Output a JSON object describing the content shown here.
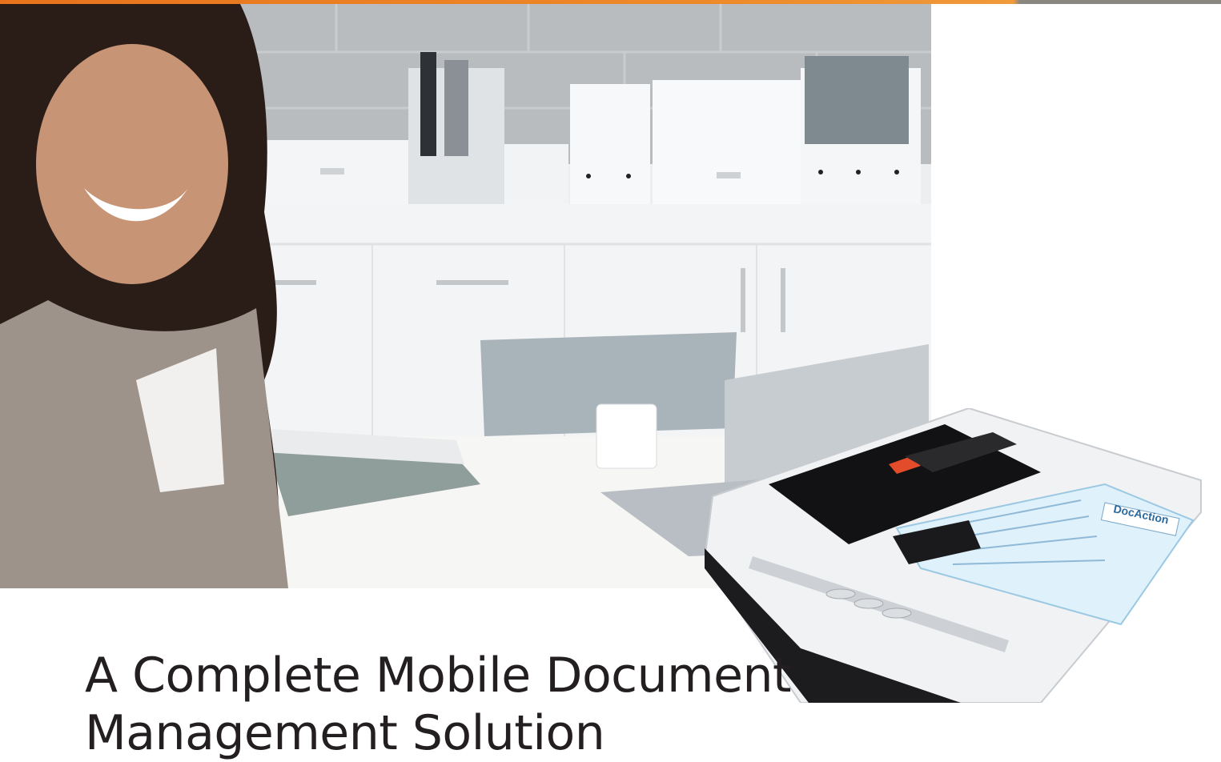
{
  "brochure": {
    "headline_line1": "A Complete Mobile Document",
    "headline_line2": "Management Solution",
    "scanner_screen_brand": "DocAction"
  },
  "colors": {
    "accent_orange": "#e8731c",
    "stripe_gray": "#8a8680",
    "headline_text": "#231f20"
  }
}
